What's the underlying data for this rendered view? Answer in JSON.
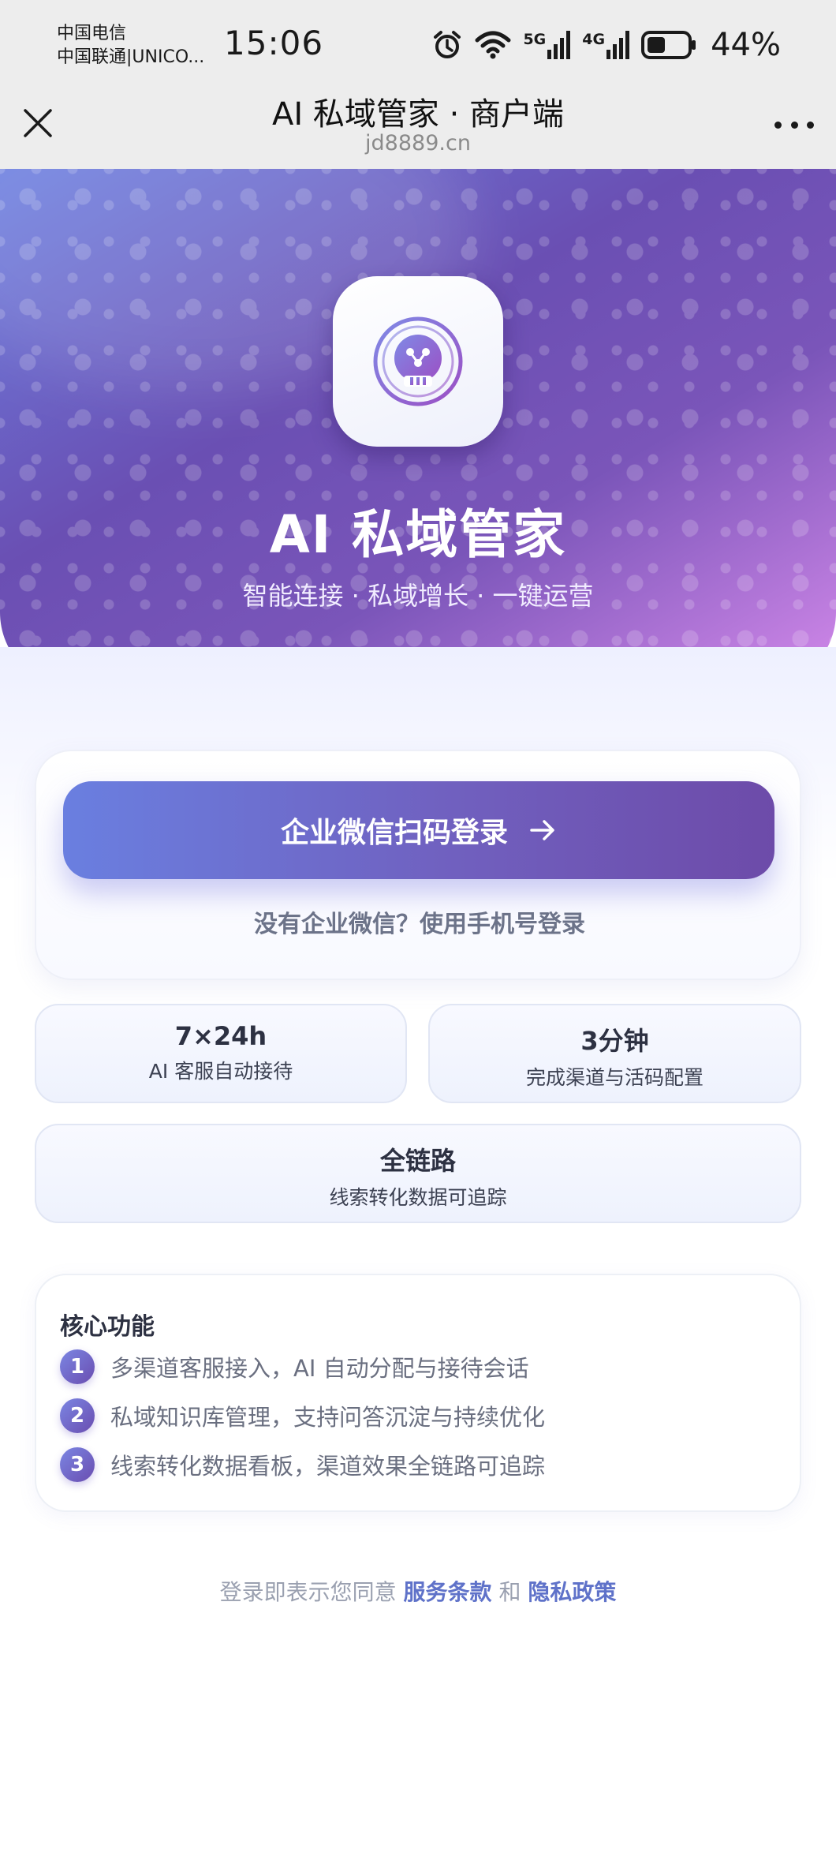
{
  "status_bar": {
    "carrier_1": "中国电信",
    "carrier_2": "中国联通|UNICO...",
    "time": "15:06",
    "network_5g": "5G",
    "network_4g": "4G",
    "battery": "44%",
    "battery_level": 0.44,
    "icons": [
      "alarm-icon",
      "wifi-icon",
      "signal-5g-icon",
      "signal-4g-icon",
      "battery-icon"
    ]
  },
  "title_bar": {
    "title": "AI 私域管家 · 商户端",
    "domain": "jd8889.cn",
    "close_icon": "close-icon",
    "more_icon": "more-icon"
  },
  "hero": {
    "title": "AI 私域管家",
    "subtitle": "智能连接 · 私域增长 · 一键运营",
    "logo_icon": "robot-logo-icon"
  },
  "login": {
    "primary_button": "企业微信扫码登录",
    "arrow_icon": "arrow-right-icon",
    "secondary_link": "没有企业微信？使用手机号登录"
  },
  "stats": [
    {
      "value": "7×24h",
      "label": "AI 客服自动接待"
    },
    {
      "value": "3分钟",
      "label": "完成渠道与活码配置"
    },
    {
      "value": "全链路",
      "label": "线索转化数据可追踪"
    }
  ],
  "features": {
    "title": "核心功能",
    "items": [
      {
        "num": "1",
        "text": "多渠道客服接入，AI 自动分配与接待会话"
      },
      {
        "num": "2",
        "text": "私域知识库管理，支持问答沉淀与持续优化"
      },
      {
        "num": "3",
        "text": "线索转化数据看板，渠道效果全链路可追踪"
      }
    ]
  },
  "agreement": {
    "prefix": "登录即表示您同意",
    "terms": "服务条款",
    "and": "和",
    "privacy": "隐私政策"
  },
  "colors": {
    "accent": "#6a7fe0",
    "accent_dark": "#6d4ba9",
    "hero_pink": "#d389ea",
    "link": "#5f72c9"
  }
}
